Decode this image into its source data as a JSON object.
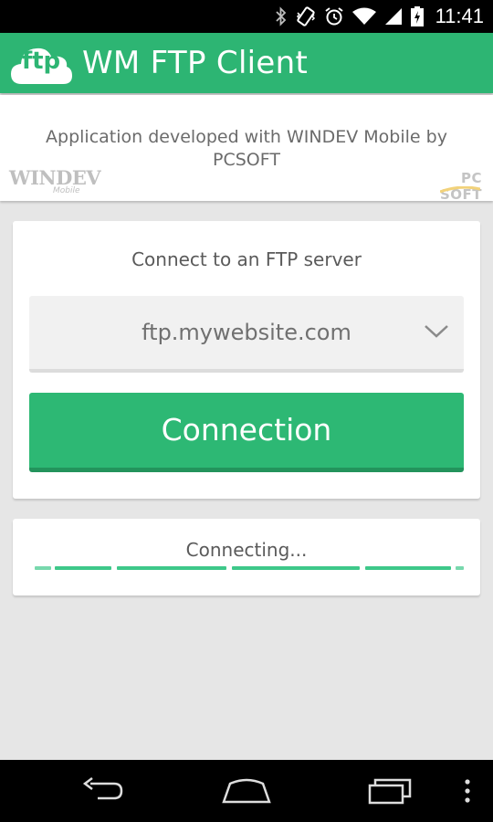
{
  "status_bar": {
    "time": "11:41",
    "icons": [
      "bluetooth-icon",
      "vibrate-icon",
      "alarm-icon",
      "wifi-icon",
      "signal-icon",
      "battery-charging-icon"
    ]
  },
  "app_bar": {
    "logo_text": "ftp",
    "title": "WM FTP Client",
    "color": "#2db573"
  },
  "info_banner": {
    "text": "Application developed with WINDEV Mobile by PCSOFT",
    "left_logo": {
      "main": "WINDEV",
      "sub": "Mobile"
    },
    "right_logo": {
      "main": "PC SOFT"
    }
  },
  "connect_card": {
    "heading": "Connect to an FTP server",
    "server_select": {
      "value": "ftp.mywebsite.com",
      "icon": "chevron-down-icon"
    },
    "connect_button": {
      "label": "Connection",
      "color": "#2db874"
    }
  },
  "progress_card": {
    "label": "Connecting...",
    "indicator": "indeterminate"
  },
  "nav_bar": {
    "buttons": [
      "back-icon",
      "home-icon",
      "recent-apps-icon",
      "overflow-menu-icon"
    ]
  }
}
